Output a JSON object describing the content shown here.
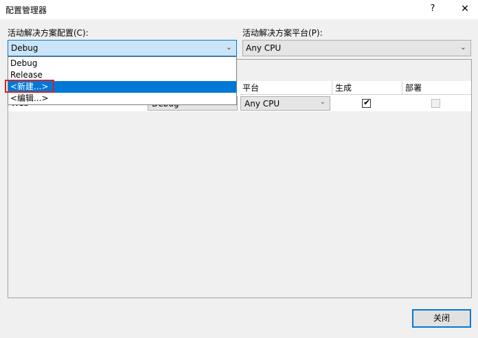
{
  "window": {
    "title": "配置管理器",
    "help_glyph": "?",
    "close_glyph": "✕"
  },
  "active_config": {
    "label": "活动解决方案配置(C):",
    "value": "Debug",
    "options": [
      "Debug",
      "Release",
      "<新建...>",
      "<编辑...>"
    ],
    "highlighted_option": "<新建...>"
  },
  "active_platform": {
    "label": "活动解决方案平台(P):",
    "value": "Any CPU"
  },
  "grid": {
    "partial_label": "",
    "headers": {
      "platform": "平台",
      "build": "生成",
      "deploy": "部署"
    },
    "row": {
      "project_partial": "Web",
      "config_partial": "Debug",
      "platform": "Any CPU",
      "build_checked": true,
      "deploy_checked": false
    }
  },
  "buttons": {
    "close": "关闭"
  },
  "colors": {
    "accent": "#0078d7",
    "highlight_border": "#d0242b"
  }
}
